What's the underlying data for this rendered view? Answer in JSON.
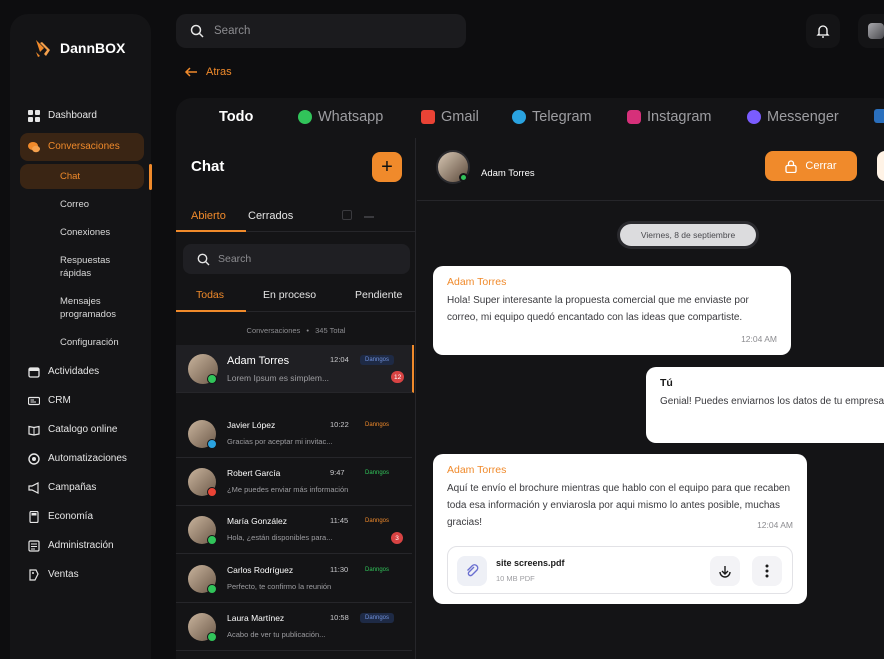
{
  "brand": {
    "name": "DannBOX"
  },
  "sidebar": {
    "items": [
      {
        "label": "Dashboard",
        "icon": "grid-icon"
      },
      {
        "label": "Conversaciones",
        "icon": "chat-bubbles-icon"
      },
      {
        "label": "Actividades",
        "icon": "calendar-icon"
      },
      {
        "label": "CRM",
        "icon": "id-card-icon"
      },
      {
        "label": "Catalogo online",
        "icon": "book-icon"
      },
      {
        "label": "Automatizaciones",
        "icon": "automation-icon"
      },
      {
        "label": "Campañas",
        "icon": "megaphone-icon"
      },
      {
        "label": "Economía",
        "icon": "calculator-icon"
      },
      {
        "label": "Administración",
        "icon": "admin-icon"
      },
      {
        "label": "Ventas",
        "icon": "sales-icon"
      }
    ],
    "sub_items": [
      "Chat",
      "Correo",
      "Conexiones",
      "Respuestas rápidas",
      "Mensajes programados",
      "Configuración"
    ]
  },
  "topbar": {
    "search_placeholder": "Search"
  },
  "back": {
    "label": "Atras"
  },
  "channels": [
    {
      "label": "Todo"
    },
    {
      "label": "Whatsapp",
      "color": "#31c45a"
    },
    {
      "label": "Gmail",
      "color": "#ea4335"
    },
    {
      "label": "Telegram",
      "color": "#2aa3e0"
    },
    {
      "label": "Instagram",
      "color": "#d6307a"
    },
    {
      "label": "Messenger",
      "color": "#7a5cff"
    }
  ],
  "list": {
    "title": "Chat",
    "tabs": [
      "Abierto",
      "Cerrados"
    ],
    "search_placeholder": "Search",
    "filters": [
      "Todas",
      "En proceso",
      "Pendiente"
    ],
    "count_label": "Conversaciones",
    "count_total": "345 Total",
    "conversations": [
      {
        "name": "Adam Torres",
        "time": "12:04",
        "preview": "Lorem Ipsum es simplem...",
        "tag": "Danngos",
        "tag_bg": "#1e2a45",
        "tag_color": "#6f8fd8",
        "unread": "12",
        "source_color": "#31c45a"
      },
      {
        "name": "Javier López",
        "time": "10:22",
        "preview": "Gracias por aceptar mi invitac...",
        "tag": "Danngos",
        "tag_bg": "transparent",
        "tag_color": "#f08a2b",
        "unread": "",
        "source_color": "#2aa3e0"
      },
      {
        "name": "Robert García",
        "time": "9:47",
        "preview": "¿Me puedes enviar más información",
        "tag": "Danngos",
        "tag_bg": "transparent",
        "tag_color": "#31c45a",
        "unread": "",
        "source_color": "#ea4335"
      },
      {
        "name": "María González",
        "time": "11:45",
        "preview": "Hola, ¿están disponibles para...",
        "tag": "Danngos",
        "tag_bg": "transparent",
        "tag_color": "#f08a2b",
        "unread": "3",
        "source_color": "#31c45a"
      },
      {
        "name": "Carlos Rodríguez",
        "time": "11:30",
        "preview": "Perfecto, te confirmo la reunión",
        "tag": "Danngos",
        "tag_bg": "transparent",
        "tag_color": "#31c45a",
        "unread": "",
        "source_color": "#31c45a"
      },
      {
        "name": "Laura Martínez",
        "time": "10:58",
        "preview": "Acabo de ver tu publicación...",
        "tag": "Danngos",
        "tag_bg": "#1e2a45",
        "tag_color": "#6f8fd8",
        "unread": "",
        "source_color": "#31c45a"
      }
    ]
  },
  "chat": {
    "contact_name": "Adam Torres",
    "close_label": "Cerrar",
    "date_label": "Viernes, 8 de septiembre",
    "messages": [
      {
        "sender": "Adam Torres",
        "text": "Hola! Super interesante la propuesta comercial que me enviaste por correo, mi equipo quedó encantado con las ideas que compartiste.",
        "time": "12:04 AM"
      },
      {
        "sender": "Tú",
        "text": "Genial! Puedes enviarnos los datos de tu empresa para comenzar con la integración cuando estés listo."
      },
      {
        "sender": "Adam Torres",
        "text": "Aquí te envío el brochure mientras que hablo con el equipo para que recaben toda esa información y enviarosla por aqui mismo lo antes posible, muchas gracias!",
        "time": "12:04 AM",
        "file_name": "site screens.pdf",
        "file_size": "10 MB PDF"
      }
    ]
  }
}
